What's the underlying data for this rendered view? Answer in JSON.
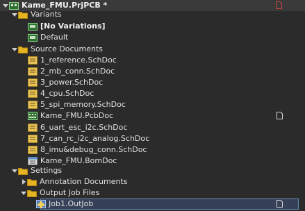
{
  "project": {
    "name": "Kame_FMU.PrjPCB *"
  },
  "variants": {
    "label": "Variants",
    "items": [
      "[No Variations]",
      "Default"
    ]
  },
  "source": {
    "label": "Source Documents",
    "items": [
      "1_reference.SchDoc",
      "2_mb_conn.SchDoc",
      "3_power.SchDoc",
      "4_cpu.SchDoc",
      "5_spi_memory.SchDoc",
      "Kame_FMU.PcbDoc",
      "6_uart_esc_i2c.SchDoc",
      "7_can_rc_i2c_analog.SchDoc",
      "8_imu&debug_conn.SchDoc",
      "Kame_FMU.BomDoc"
    ]
  },
  "settings": {
    "label": "Settings",
    "annotation": "Annotation Documents",
    "output": "Output Job Files",
    "job": "Job1.OutJob"
  },
  "colors": {
    "folder": "#e6b422",
    "schdoc": "#e8c35a",
    "pcb_green": "#3c8a3c",
    "modified_red": "#d04040",
    "selection": "#364158"
  }
}
